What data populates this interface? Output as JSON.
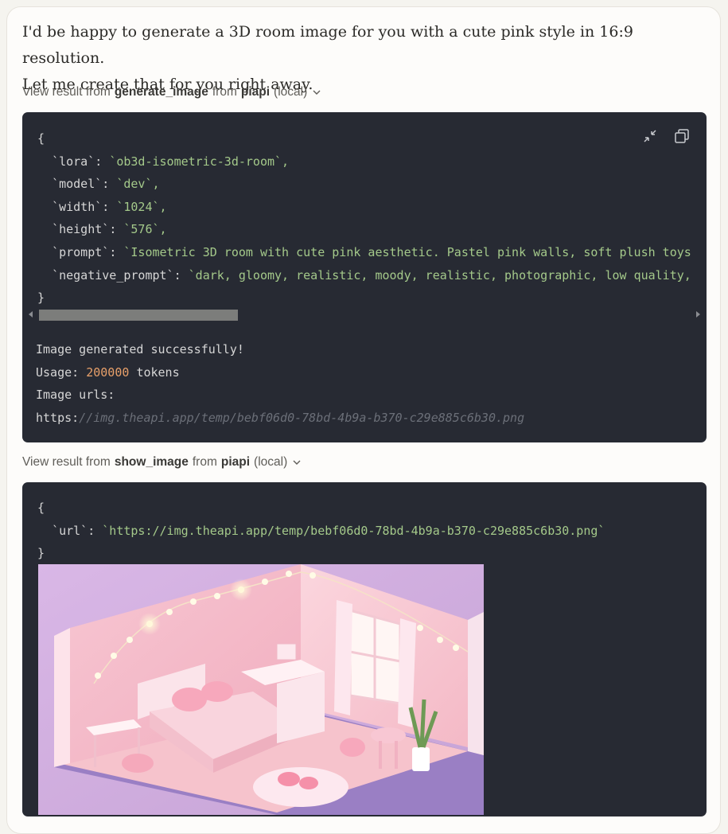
{
  "message": {
    "line1": "I'd be happy to generate a 3D room image for you with a cute pink style in 16:9 resolution.",
    "line2": "Let me create that for you right away."
  },
  "tool1": {
    "prefix": "View result from",
    "tool": "generate_image",
    "from": "from",
    "server": "piapi",
    "location": "(local)",
    "code": {
      "open": "{",
      "close": "}",
      "lines": [
        {
          "key": "`lora`",
          "value": "`ob3d-isometric-3d-room`,"
        },
        {
          "key": "`model`",
          "value": "`dev`,"
        },
        {
          "key": "`width`",
          "value": "`1024`,"
        },
        {
          "key": "`height`",
          "value": "`576`,"
        },
        {
          "key": "`prompt`",
          "value": "`Isometric 3D room with cute pink aesthetic. Pastel pink walls, soft plush toys"
        },
        {
          "key": "`negative_prompt`",
          "value": "`dark, gloomy, realistic, moody, realistic, photographic, low quality,"
        }
      ]
    },
    "result": {
      "line1": "Image generated successfully!",
      "usage_label": "Usage:",
      "usage_value": "200000",
      "usage_unit": "tokens",
      "urls_label": "Image urls:",
      "url_scheme": "https:",
      "url_rest": "//img.theapi.app/temp/bebf06d0-78bd-4b9a-b370-c29e885c6b30.png"
    },
    "icons": [
      "collapse-icon",
      "copy-icon"
    ]
  },
  "tool2": {
    "prefix": "View result from",
    "tool": "show_image",
    "from": "from",
    "server": "piapi",
    "location": "(local)",
    "code": {
      "open": "{",
      "close": "}",
      "key": "`url`",
      "value": "`https://img.theapi.app/temp/bebf06d0-78bd-4b9a-b370-c29e885c6b30.png`"
    }
  },
  "colors": {
    "code_bg": "#272a33",
    "string": "#a4c98a",
    "number": "#e8a06a"
  }
}
